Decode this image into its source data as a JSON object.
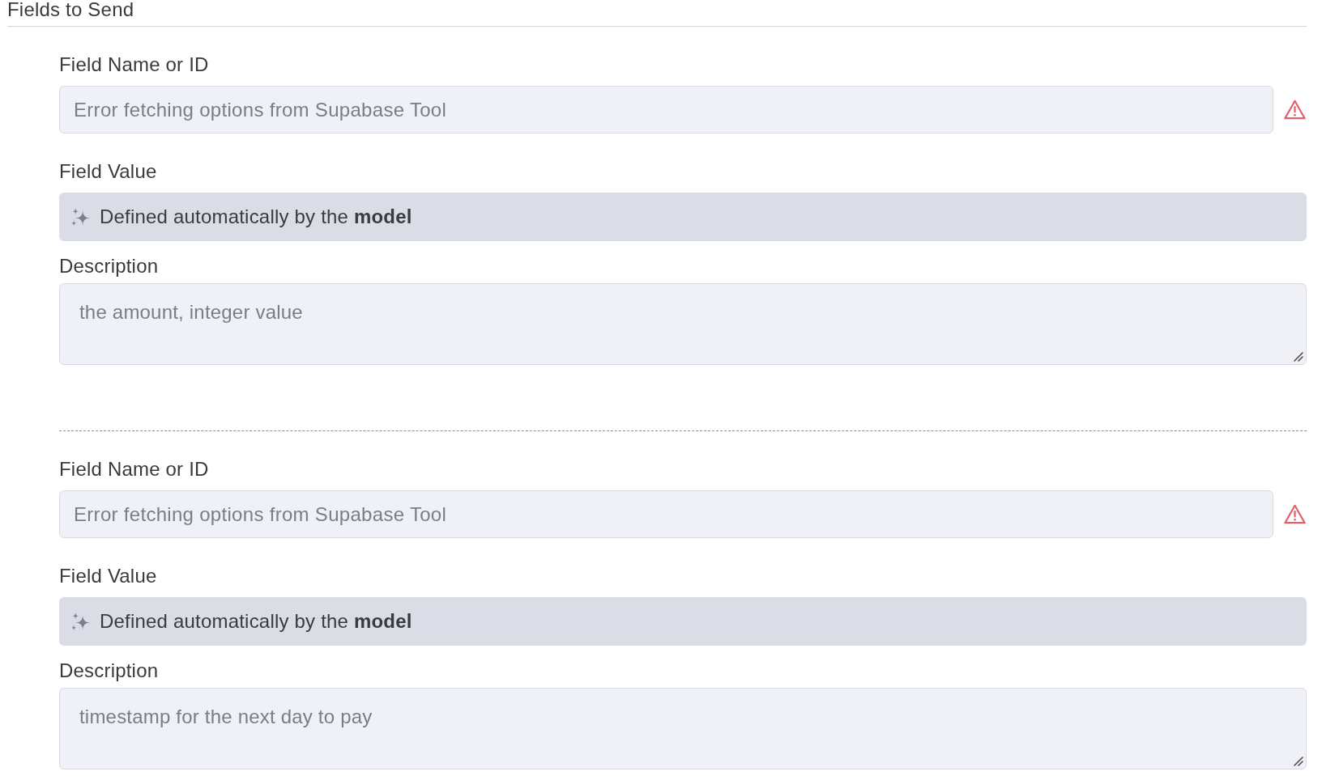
{
  "section": {
    "title": "Fields to Send"
  },
  "fields": [
    {
      "name_label": "Field Name or ID",
      "name_placeholder": "Error fetching options from Supabase Tool",
      "name_error": true,
      "value_label": "Field Value",
      "value_text": "Defined automatically by the **model**",
      "description_label": "Description",
      "description_placeholder": "the amount, integer value"
    },
    {
      "name_label": "Field Name or ID",
      "name_placeholder": "Error fetching options from Supabase Tool",
      "name_error": true,
      "value_label": "Field Value",
      "value_text": "Defined automatically by the **model**",
      "description_label": "Description",
      "description_placeholder": "timestamp for the next day to pay"
    }
  ]
}
